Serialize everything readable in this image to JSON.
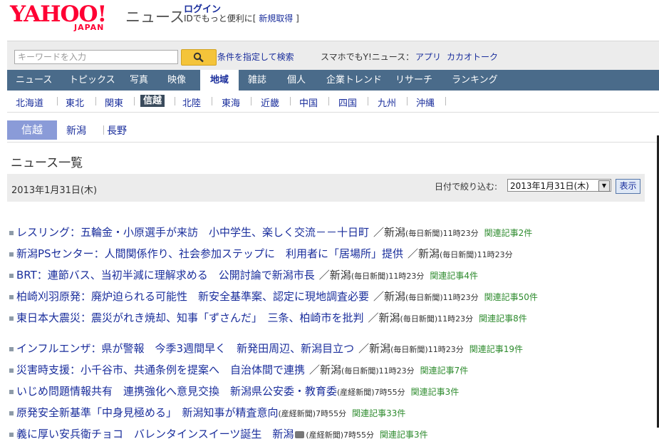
{
  "header": {
    "logo_text": "YAHOO!",
    "logo_sub": "JAPAN",
    "service": "ニュース",
    "login": "ログイン",
    "id_text": "IDでもっと便利に",
    "register": "新規取得"
  },
  "search": {
    "placeholder": "キーワードを入力",
    "condition_link": "条件を指定して検索",
    "smartphone_label": "スマホでもY!ニュース：",
    "app_link": "アプリ",
    "kakao_link": "カカオトーク"
  },
  "nav": {
    "items": [
      "ニュース",
      "トピックス",
      "写真",
      "映像",
      "地域",
      "雑誌",
      "個人",
      "企業トレンド",
      "リサーチ",
      "ランキング"
    ],
    "active": "地域"
  },
  "regions": {
    "items": [
      "北海道",
      "東北",
      "関東",
      "信越",
      "北陸",
      "東海",
      "近畿",
      "中国",
      "四国",
      "九州",
      "沖縄"
    ],
    "active": "信越"
  },
  "prefectures": {
    "current": "信越",
    "items": [
      "新潟",
      "長野"
    ]
  },
  "page_title": "ニュース一覧",
  "date_bar": {
    "date": "2013年1月31日(木)",
    "filter_label": "日付で絞り込む:",
    "selected_date": "2013年1月31日(木)",
    "show_button": "表示"
  },
  "news": [
    {
      "title": "レスリング：五輪金・小原選手が来訪　小中学生、楽しく交流－－十日町",
      "src": "／新潟",
      "pub": "(毎日新聞)",
      "time": "11時23分",
      "rel": "関連記事2件"
    },
    {
      "title": "新潟PSセンター：人間関係作り、社会参加ステップに　利用者に「居場所」提供",
      "src": "／新潟",
      "pub": "(毎日新聞)",
      "time": "11時23分",
      "rel": ""
    },
    {
      "title": "BRT：連節バス、当初半減に理解求める　公開討論で新潟市長",
      "src": "／新潟",
      "pub": "(毎日新聞)",
      "time": "11時23分",
      "rel": "関連記事4件"
    },
    {
      "title": "柏崎刈羽原発：廃炉迫られる可能性　新安全基準案、認定に現地調査必要",
      "src": "／新潟",
      "pub": "(毎日新聞)",
      "time": "11時23分",
      "rel": "関連記事50件"
    },
    {
      "title": "東日本大震災：震災がれき焼却、知事「ずさんだ」　三条、柏崎市を批判",
      "src": "／新潟",
      "pub": "(毎日新聞)",
      "time": "11時23分",
      "rel": "関連記事8件"
    },
    {
      "title": "インフルエンザ：県が警報　今季3週間早く　新発田周辺、新潟目立つ",
      "src": "／新潟",
      "pub": "(毎日新聞)",
      "time": "11時23分",
      "rel": "関連記事19件"
    },
    {
      "title": "災害時支援：小千谷市、共通条例を提案へ　自治体間で連携",
      "src": "／新潟",
      "pub": "(毎日新聞)",
      "time": "11時23分",
      "rel": "関連記事7件"
    },
    {
      "title": "いじめ問題情報共有　連携強化へ意見交換　新潟県公安委・教育委",
      "src": "",
      "pub": "(産経新聞)",
      "time": "7時55分",
      "rel": "関連記事3件"
    },
    {
      "title": "原発安全新基準「中身見極める」　新潟知事が精査意向",
      "src": "",
      "pub": "(産経新聞)",
      "time": "7時55分",
      "rel": "関連記事33件"
    },
    {
      "title": "義に厚い安兵衛チョコ　バレンタインスイーツ誕生　新潟",
      "src": "",
      "pub": "(産経新聞)",
      "time": "7時55分",
      "rel": "関連記事3件",
      "camera": true
    }
  ]
}
